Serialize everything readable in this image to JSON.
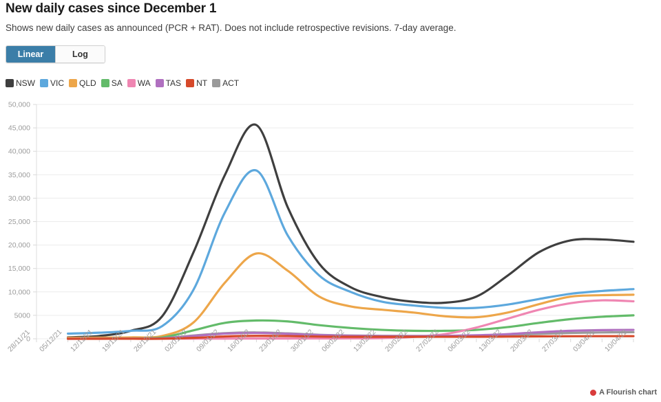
{
  "header": {
    "title": "New daily cases since December 1",
    "subtitle": "Shows new daily cases as announced (PCR + RAT). Does not include retrospective revisions. 7-day average."
  },
  "controls": {
    "scale_toggle": {
      "options": [
        "Linear",
        "Log"
      ],
      "selected": "Linear",
      "linear_label": "Linear",
      "log_label": "Log",
      "active_color": "#3b7ea8"
    }
  },
  "credit": {
    "text": "A Flourish chart",
    "dot_color": "#d93c3c",
    "dot_icon": "flourish-dot-icon"
  },
  "chart_data": {
    "type": "line",
    "title": "New daily cases since December 1",
    "subtitle": "Shows new daily cases as announced (PCR + RAT). Does not include retrospective revisions. 7-day average.",
    "xlabel": "",
    "ylabel": "",
    "ylim": [
      0,
      50000
    ],
    "yticks": [
      0,
      5000,
      10000,
      15000,
      20000,
      25000,
      30000,
      35000,
      40000,
      45000,
      50000
    ],
    "ytick_labels": [
      "0",
      "5000",
      "10,000",
      "15,000",
      "20,000",
      "25,000",
      "30,000",
      "35,000",
      "40,000",
      "45,000",
      "50,000"
    ],
    "grid": true,
    "legend_position": "top-left",
    "xtick_labels": [
      "28/11/21",
      "05/12/21",
      "12/12/21",
      "19/12/21",
      "26/12/21",
      "02/01/22",
      "09/01/22",
      "16/01/22",
      "23/01/22",
      "30/01/22",
      "06/02/22",
      "13/02/22",
      "20/02/22",
      "27/02/22",
      "06/03/22",
      "13/03/22",
      "20/03/22",
      "27/03/22",
      "03/04/22",
      "10/04/22"
    ],
    "x": [
      "05/12/21",
      "12/12/21",
      "19/12/21",
      "26/12/21",
      "02/01/22",
      "09/01/22",
      "16/01/22",
      "23/01/22",
      "30/01/22",
      "06/02/22",
      "13/02/22",
      "20/02/22",
      "27/02/22",
      "06/03/22",
      "13/03/22",
      "20/03/22",
      "27/03/22",
      "03/04/22",
      "10/04/22"
    ],
    "series": [
      {
        "name": "NSW",
        "color": "#3f3f3f",
        "values": [
          300,
          600,
          1700,
          4800,
          18500,
          35000,
          45600,
          28000,
          16000,
          11000,
          8900,
          7900,
          7700,
          9000,
          13500,
          18500,
          21000,
          21200,
          20700
        ]
      },
      {
        "name": "VIC",
        "color": "#5da8dd",
        "values": [
          1100,
          1300,
          1700,
          2700,
          10500,
          27000,
          35900,
          22000,
          13500,
          10000,
          7900,
          7100,
          6600,
          6600,
          7300,
          8500,
          9600,
          10200,
          10600
        ]
      },
      {
        "name": "QLD",
        "color": "#eda64a",
        "values": [
          200,
          250,
          300,
          600,
          3500,
          12000,
          18200,
          14500,
          9000,
          6900,
          6200,
          5600,
          4800,
          4600,
          5600,
          7400,
          9000,
          9300,
          9400
        ]
      },
      {
        "name": "SA",
        "color": "#63bb6a",
        "values": [
          20,
          30,
          60,
          280,
          1800,
          3400,
          3900,
          3700,
          2900,
          2300,
          1900,
          1700,
          1700,
          1900,
          2500,
          3400,
          4200,
          4700,
          5000
        ]
      },
      {
        "name": "WA",
        "color": "#ef86b2",
        "values": [
          10,
          10,
          15,
          20,
          30,
          40,
          50,
          60,
          70,
          90,
          150,
          400,
          1000,
          2400,
          4300,
          6200,
          7600,
          8200,
          8000
        ]
      },
      {
        "name": "TAS",
        "color": "#b070c0",
        "values": [
          5,
          8,
          10,
          60,
          600,
          1100,
          1250,
          1050,
          800,
          650,
          580,
          560,
          600,
          750,
          1000,
          1400,
          1700,
          1850,
          1900
        ]
      },
      {
        "name": "NT",
        "color": "#d6492a",
        "values": [
          5,
          5,
          8,
          20,
          200,
          500,
          620,
          580,
          470,
          420,
          420,
          420,
          430,
          440,
          470,
          510,
          540,
          560,
          560
        ]
      },
      {
        "name": "ACT",
        "color": "#9a9a9a",
        "values": [
          10,
          15,
          25,
          120,
          700,
          1200,
          1350,
          1150,
          850,
          700,
          620,
          600,
          620,
          700,
          850,
          1050,
          1250,
          1350,
          1400
        ]
      }
    ]
  }
}
